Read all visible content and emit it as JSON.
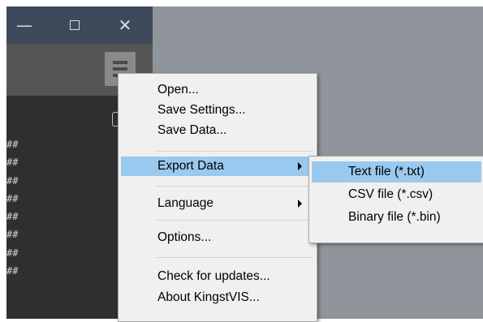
{
  "window": {
    "min_glyph": "—",
    "close_glyph": "✕"
  },
  "panel": {
    "rows": [
      "##",
      "##",
      "##",
      "##",
      "##",
      "##",
      "##",
      "##"
    ]
  },
  "menu": {
    "items": [
      {
        "label": "Open..."
      },
      {
        "label": "Save Settings..."
      },
      {
        "label": "Save Data..."
      },
      {
        "label": "Export Data",
        "submenu": true,
        "highlighted": true
      },
      {
        "label": "Language",
        "submenu": true
      },
      {
        "label": "Options..."
      },
      {
        "label": "Check for updates..."
      },
      {
        "label": "About KingstVIS..."
      }
    ]
  },
  "submenu": {
    "items": [
      {
        "label": "Text file (*.txt)",
        "highlighted": true
      },
      {
        "label": "CSV file (*.csv)"
      },
      {
        "label": "Binary file (*.bin)"
      }
    ]
  },
  "colors": {
    "titlebar": "#3e4a5b",
    "highlight": "#99c9ef",
    "menu_bg": "#f0f0f0",
    "panel_bg": "#2f2f2f",
    "right_bg": "#8f959b"
  }
}
